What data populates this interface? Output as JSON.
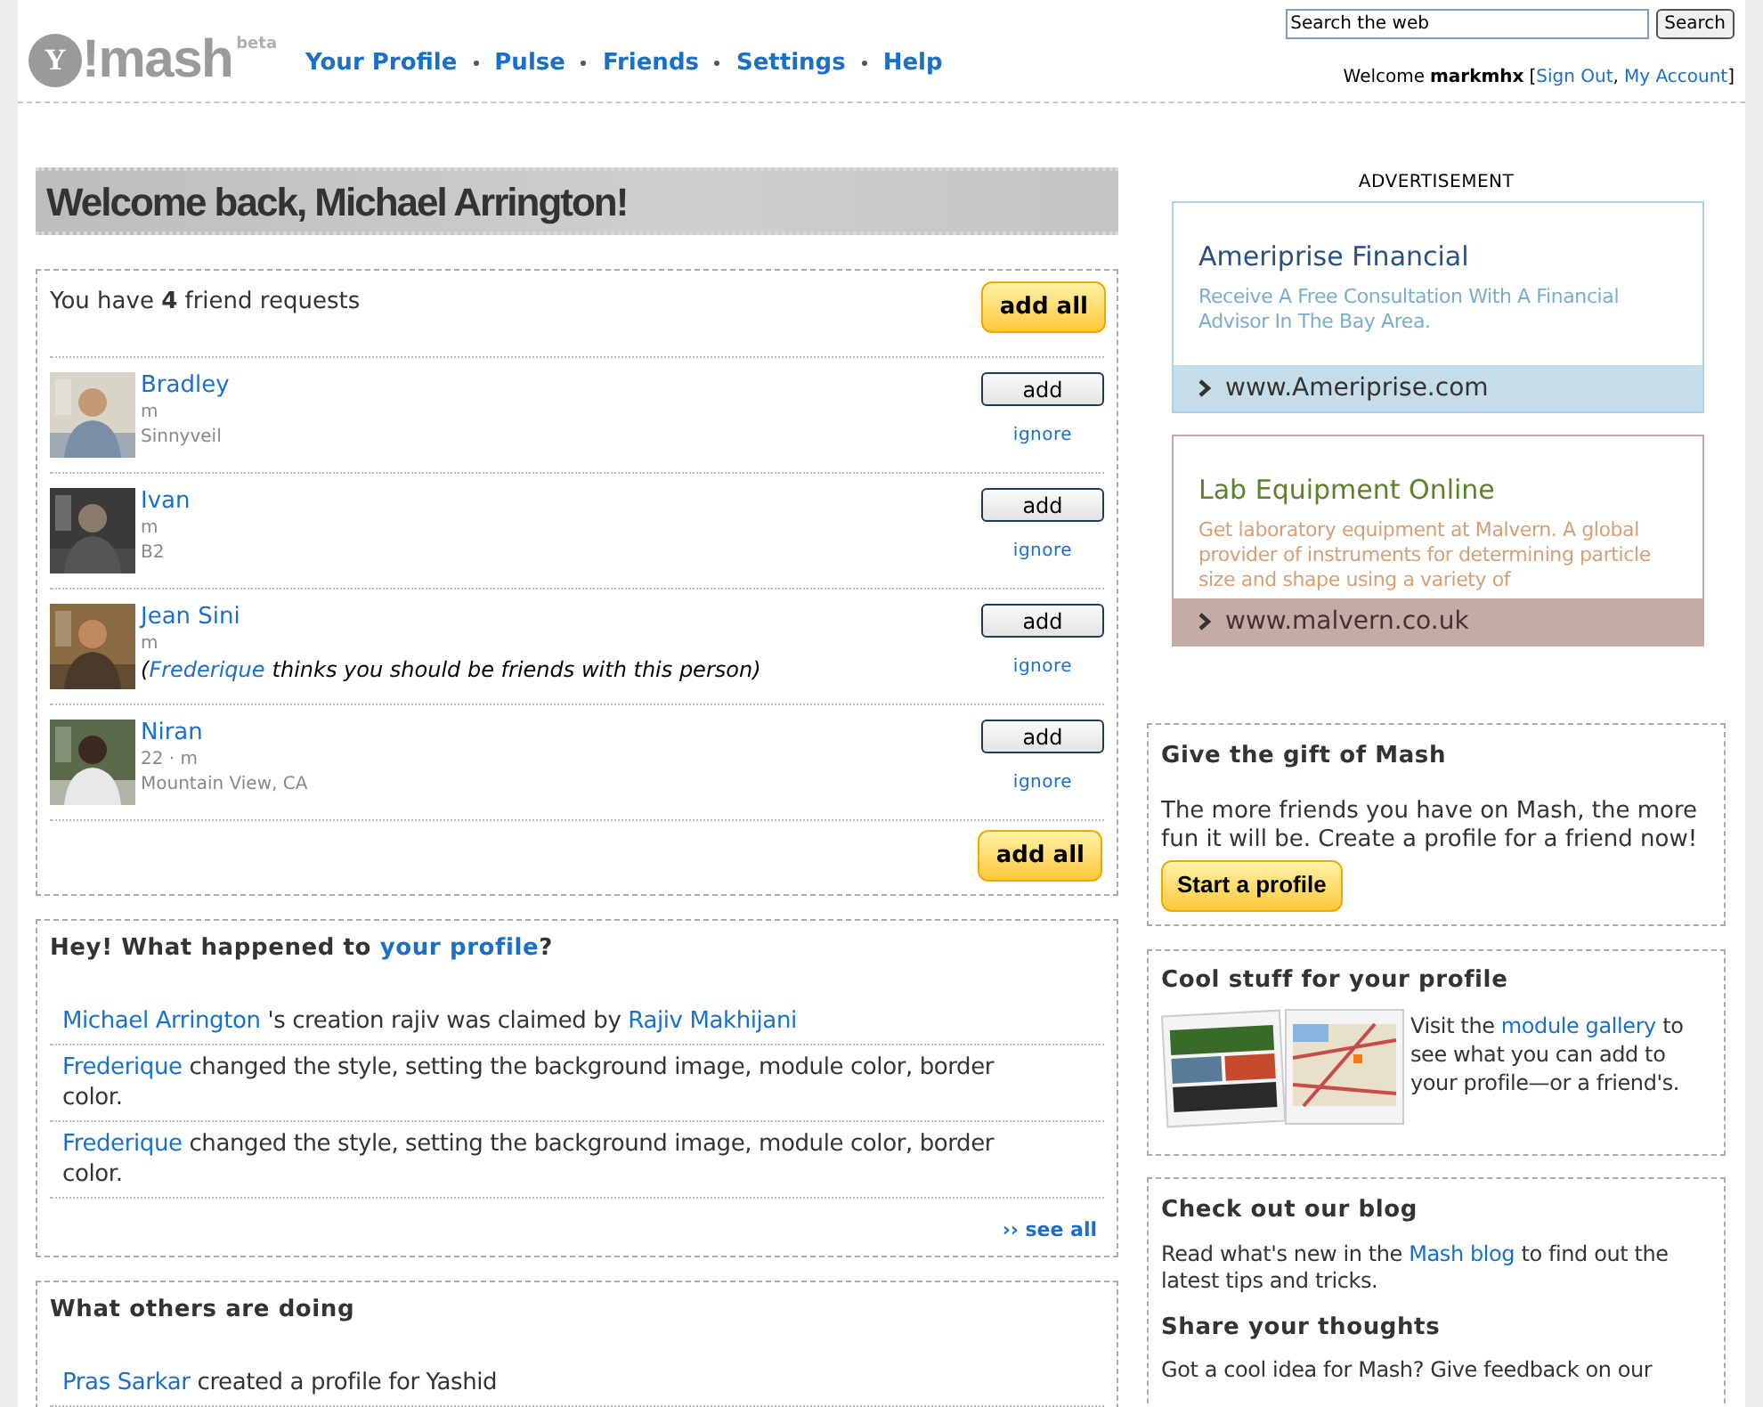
{
  "header": {
    "logo": {
      "mark": "Y",
      "text": "!mash",
      "badge": "beta"
    },
    "nav": [
      {
        "label": "Your Profile"
      },
      {
        "label": "Pulse"
      },
      {
        "label": "Friends"
      },
      {
        "label": "Settings"
      },
      {
        "label": "Help"
      }
    ],
    "search": {
      "value": "Search the web",
      "button": "Search"
    },
    "account": {
      "welcome": "Welcome",
      "user": "markmhx",
      "open": "[",
      "sign_out": "Sign Out",
      "comma": ",",
      "my_account": "My Account",
      "close": "]"
    }
  },
  "welcome": "Welcome back, Michael Arrington!",
  "friend_requests": {
    "summary": "You have **4** friend requests",
    "add_all": "add all",
    "items": [
      {
        "name": "Bradley",
        "details": [
          "m",
          "Sinnyveil"
        ],
        "add": "add",
        "ignore": "ignore"
      },
      {
        "name": "Ivan",
        "details": [
          "m",
          "B2"
        ],
        "add": "add",
        "ignore": "ignore"
      },
      {
        "name": "Jean Sini",
        "details": [
          "m"
        ],
        "note": {
          "open": "(",
          "recommender": "Frederique",
          "text": "thinks you should be friends with this person)"
        },
        "add": "add",
        "ignore": "ignore"
      },
      {
        "name": "Niran",
        "details": [
          "22 · m",
          "Mountain View, CA"
        ],
        "add": "add",
        "ignore": "ignore"
      }
    ],
    "add_all_bottom": "add all"
  },
  "profile_activity": {
    "title": "Hey! What happened to",
    "title_link": "your profile",
    "title_end": "?",
    "items": [
      {
        "actor": "Michael Arrington",
        "text": "'s creation rajiv was claimed by",
        "target": "Rajiv Makhijani"
      },
      {
        "actor": "Frederique",
        "text": "changed the style, setting the background image, module color, border color."
      },
      {
        "actor": "Frederique",
        "text": "changed the style, setting the background image, module color, border color."
      }
    ],
    "see_all": "›› see all"
  },
  "others": {
    "title": "What others are doing",
    "items": [
      {
        "actor": "Pras Sarkar",
        "text": "created a profile for Yashid"
      }
    ]
  },
  "advertisement": {
    "label": "ADVERTISEMENT",
    "ads": [
      {
        "title": "Ameriprise Financial",
        "text": "Receive A Free Consultation With A Financial Advisor In The Bay Area.",
        "url": "www.Ameriprise.com",
        "color": "#2b4f80"
      },
      {
        "title": "Lab Equipment Online",
        "text": "Get laboratory equipment at Malvern. A global provider of instruments for determining particle size and shape using a variety of",
        "url": "www.malvern.co.uk",
        "color": "#5e7f2c"
      }
    ]
  },
  "gift": {
    "title": "Give the gift of Mash",
    "text": "The more friends you have on Mash, the more fun it will be. Create a profile for a friend now!",
    "button": "Start a profile"
  },
  "cool_stuff": {
    "title": "Cool stuff for your profile",
    "before": "Visit the",
    "link": "module gallery",
    "after": "to see what you can add to your profile—or a friend's."
  },
  "blog": {
    "title": "Check out our blog",
    "before": "Read what's new in the",
    "link": "Mash blog",
    "after": "to find out the latest tips and tricks.",
    "title2": "Share your thoughts",
    "text2": "Got a cool idea for Mash? Give feedback on our"
  }
}
